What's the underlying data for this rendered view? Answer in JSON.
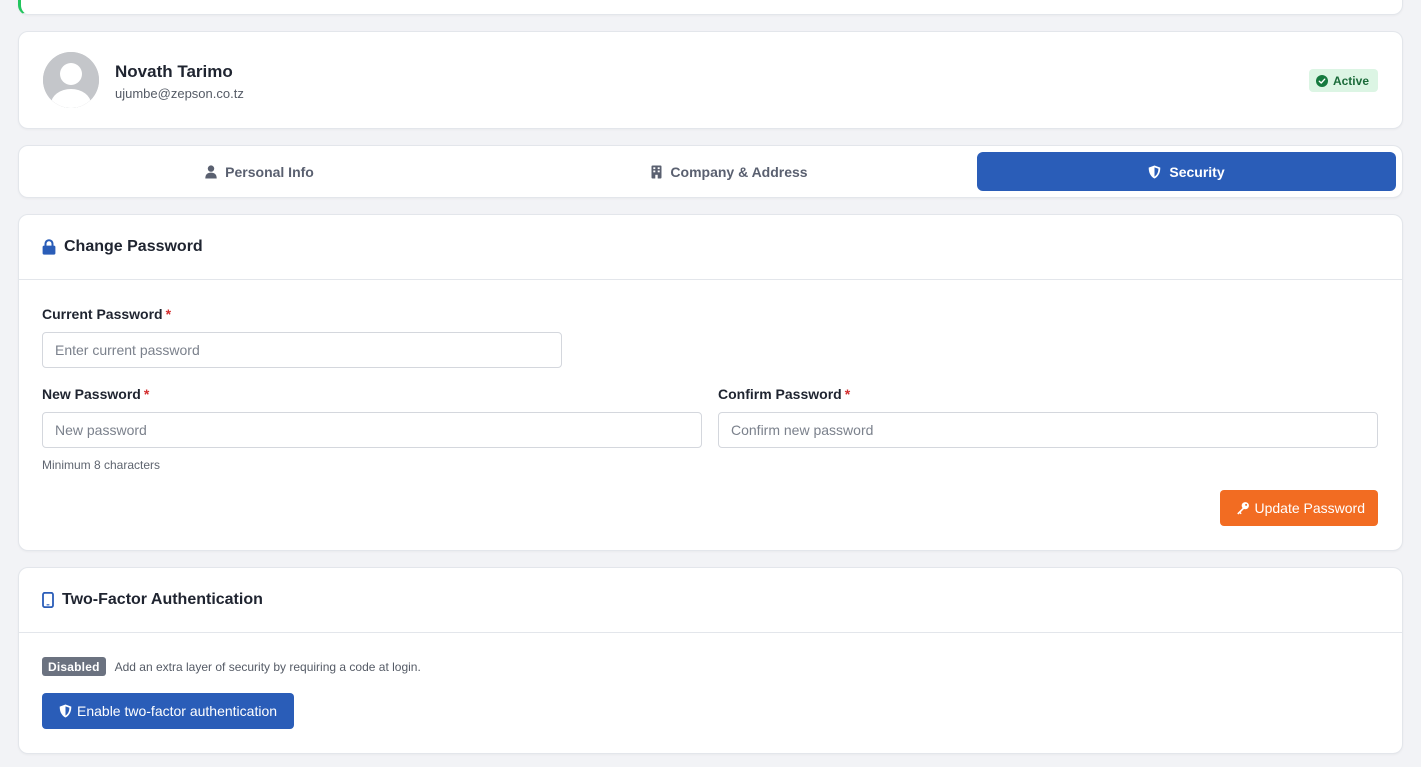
{
  "profile": {
    "name": "Novath Tarimo",
    "email": "ujumbe@zepson.co.tz",
    "status": "Active"
  },
  "tabs": [
    {
      "label": "Personal Info",
      "icon": "user-icon",
      "active": false
    },
    {
      "label": "Company & Address",
      "icon": "building-icon",
      "active": false
    },
    {
      "label": "Security",
      "icon": "shield-icon",
      "active": true
    }
  ],
  "change_password": {
    "title": "Change Password",
    "current": {
      "label": "Current Password",
      "required": "*",
      "placeholder": "Enter current password"
    },
    "new": {
      "label": "New Password",
      "required": "*",
      "placeholder": "New password",
      "hint": "Minimum 8 characters"
    },
    "confirm": {
      "label": "Confirm Password",
      "required": "*",
      "placeholder": "Confirm new password"
    },
    "submit_label": "Update Password"
  },
  "two_factor": {
    "title": "Two-Factor Authentication",
    "status": "Disabled",
    "description": "Add an extra layer of security by requiring a code at login.",
    "enable_label": "Enable two-factor authentication"
  },
  "colors": {
    "primary": "#2a5db8",
    "accent": "#f26c22",
    "success": "#167a3f",
    "danger": "#d32f2f"
  }
}
